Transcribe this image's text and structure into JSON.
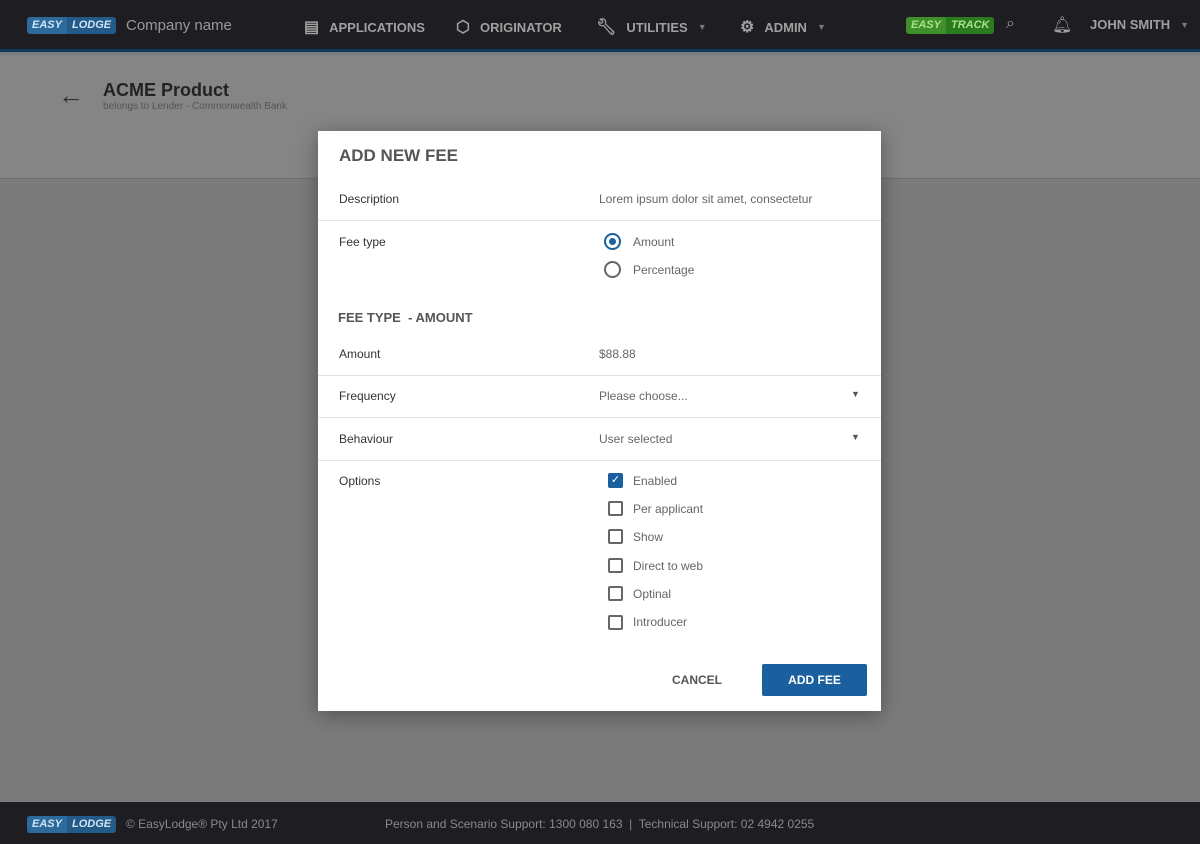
{
  "header": {
    "logo": [
      "EASY",
      "LODGE"
    ],
    "company": "Company name",
    "nav": [
      {
        "label": "APPLICATIONS",
        "icon": "document-icon"
      },
      {
        "label": "ORIGINATOR",
        "icon": "cube-icon"
      },
      {
        "label": "UTILITIES",
        "icon": "wrench-icon"
      },
      {
        "label": "ADMIN",
        "icon": "gear-icon"
      }
    ],
    "track_logo": [
      "EASY",
      "TRACK"
    ],
    "user": "JOHN SMITH"
  },
  "page": {
    "title": "ACME Product",
    "subtitle": "belongs to Lender - Commonwealth Bank"
  },
  "dialog": {
    "title": "ADD NEW FEE",
    "description_label": "Description",
    "description_value": "Lorem ipsum dolor sit amet, consectetur",
    "fee_type_label": "Fee type",
    "fee_type_options": [
      "Amount",
      "Percentage"
    ],
    "fee_type_selected": "Amount",
    "section": "FEE TYPE  - AMOUNT",
    "amount_label": "Amount",
    "amount_value": "$88.88",
    "frequency_label": "Frequency",
    "frequency_value": "Please choose...",
    "behaviour_label": "Behaviour",
    "behaviour_value": "User selected",
    "options_label": "Options",
    "options": [
      {
        "label": "Enabled",
        "checked": true
      },
      {
        "label": "Per applicant",
        "checked": false
      },
      {
        "label": "Show",
        "checked": false
      },
      {
        "label": "Direct to web",
        "checked": false
      },
      {
        "label": "Optinal",
        "checked": false
      },
      {
        "label": "Introducer",
        "checked": false
      }
    ],
    "cancel": "CANCEL",
    "submit": "ADD FEE",
    "accent": "#1a5f9e"
  },
  "footer": {
    "logo": [
      "EASY",
      "LODGE"
    ],
    "copyright": "© EasyLodge® Pty Ltd 2017",
    "support": "Person and Scenario Support: 1300 080 163  |  Technical Support: 02 4942 0255"
  }
}
